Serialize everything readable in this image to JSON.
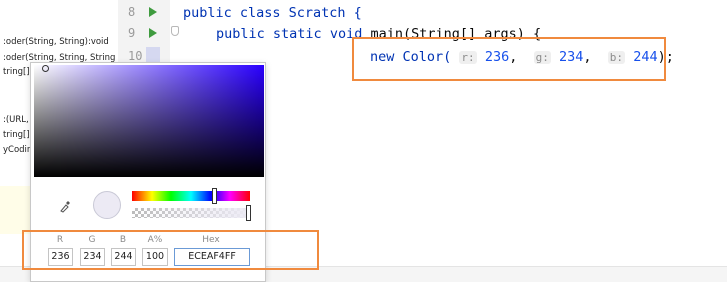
{
  "structure_panel": {
    "items": [
      ":oder(String, String):void",
      ":oder(String, String, String",
      "tring[]):",
      ":(URL,",
      "tring[]):",
      "yCodin"
    ]
  },
  "gutter": {
    "line_numbers": [
      "8",
      "9",
      "10"
    ]
  },
  "code": {
    "line1": "public class Scratch {",
    "line2_kw1": "public",
    "line2_kw2": "static",
    "line2_kw3": "void",
    "line2_rest": "main(String[] args) {",
    "line3_prefix": "new Color(",
    "hint_r": "r:",
    "hint_g": "g:",
    "hint_b": "b:",
    "r_value": "236",
    "g_value": "234",
    "b_value": "244",
    "comma": ",",
    "suffix": ");"
  },
  "color_picker": {
    "selected_color": "#ECEAF4",
    "labels": {
      "r": "R",
      "g": "G",
      "b": "B",
      "alpha": "A%",
      "hex": "Hex"
    },
    "values": {
      "r": "236",
      "g": "234",
      "b": "244",
      "alpha": "100",
      "hex": "ECEAF4FF"
    }
  },
  "colors": {
    "highlight_border": "#f08a3e",
    "keyword": "#0033b3",
    "number": "#1750eb",
    "run_icon": "#3f9b3f"
  },
  "icons": [
    "run-icon",
    "bookmark-icon",
    "pipette-icon"
  ]
}
